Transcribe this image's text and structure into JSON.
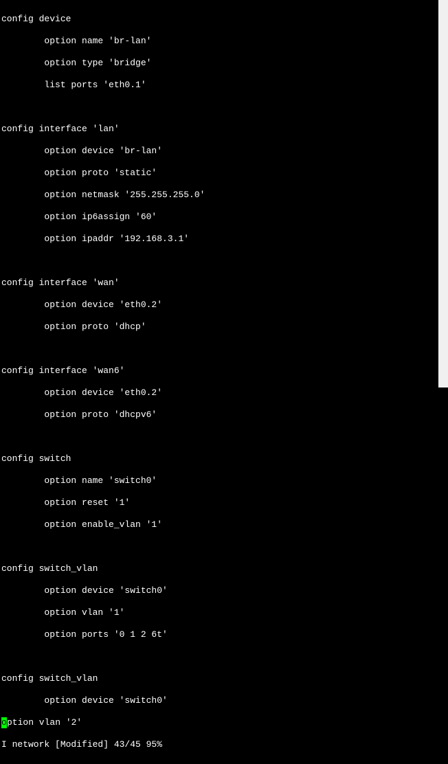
{
  "editor": {
    "lines": [
      "config device",
      "        option name 'br-lan'",
      "        option type 'bridge'",
      "        list ports 'eth0.1'",
      "",
      "config interface 'lan'",
      "        option device 'br-lan'",
      "        option proto 'static'",
      "        option netmask '255.255.255.0'",
      "        option ip6assign '60'",
      "        option ipaddr '192.168.3.1'",
      "",
      "config interface 'wan'",
      "        option device 'eth0.2'",
      "        option proto 'dhcp'",
      "",
      "config interface 'wan6'",
      "        option device 'eth0.2'",
      "        option proto 'dhcpv6'",
      "",
      "config switch",
      "        option name 'switch0'",
      "        option reset '1'",
      "        option enable_vlan '1'",
      "",
      "config switch_vlan",
      "        option device 'switch0'",
      "        option vlan '1'",
      "        option ports '0 1 2 6t'",
      "",
      "config switch_vlan",
      "        option device 'switch0'"
    ],
    "cursor_line_prefix": "o",
    "cursor_line_suffix": "ption vlan '2'",
    "status_line": "I network [Modified] 43/45 95%"
  }
}
